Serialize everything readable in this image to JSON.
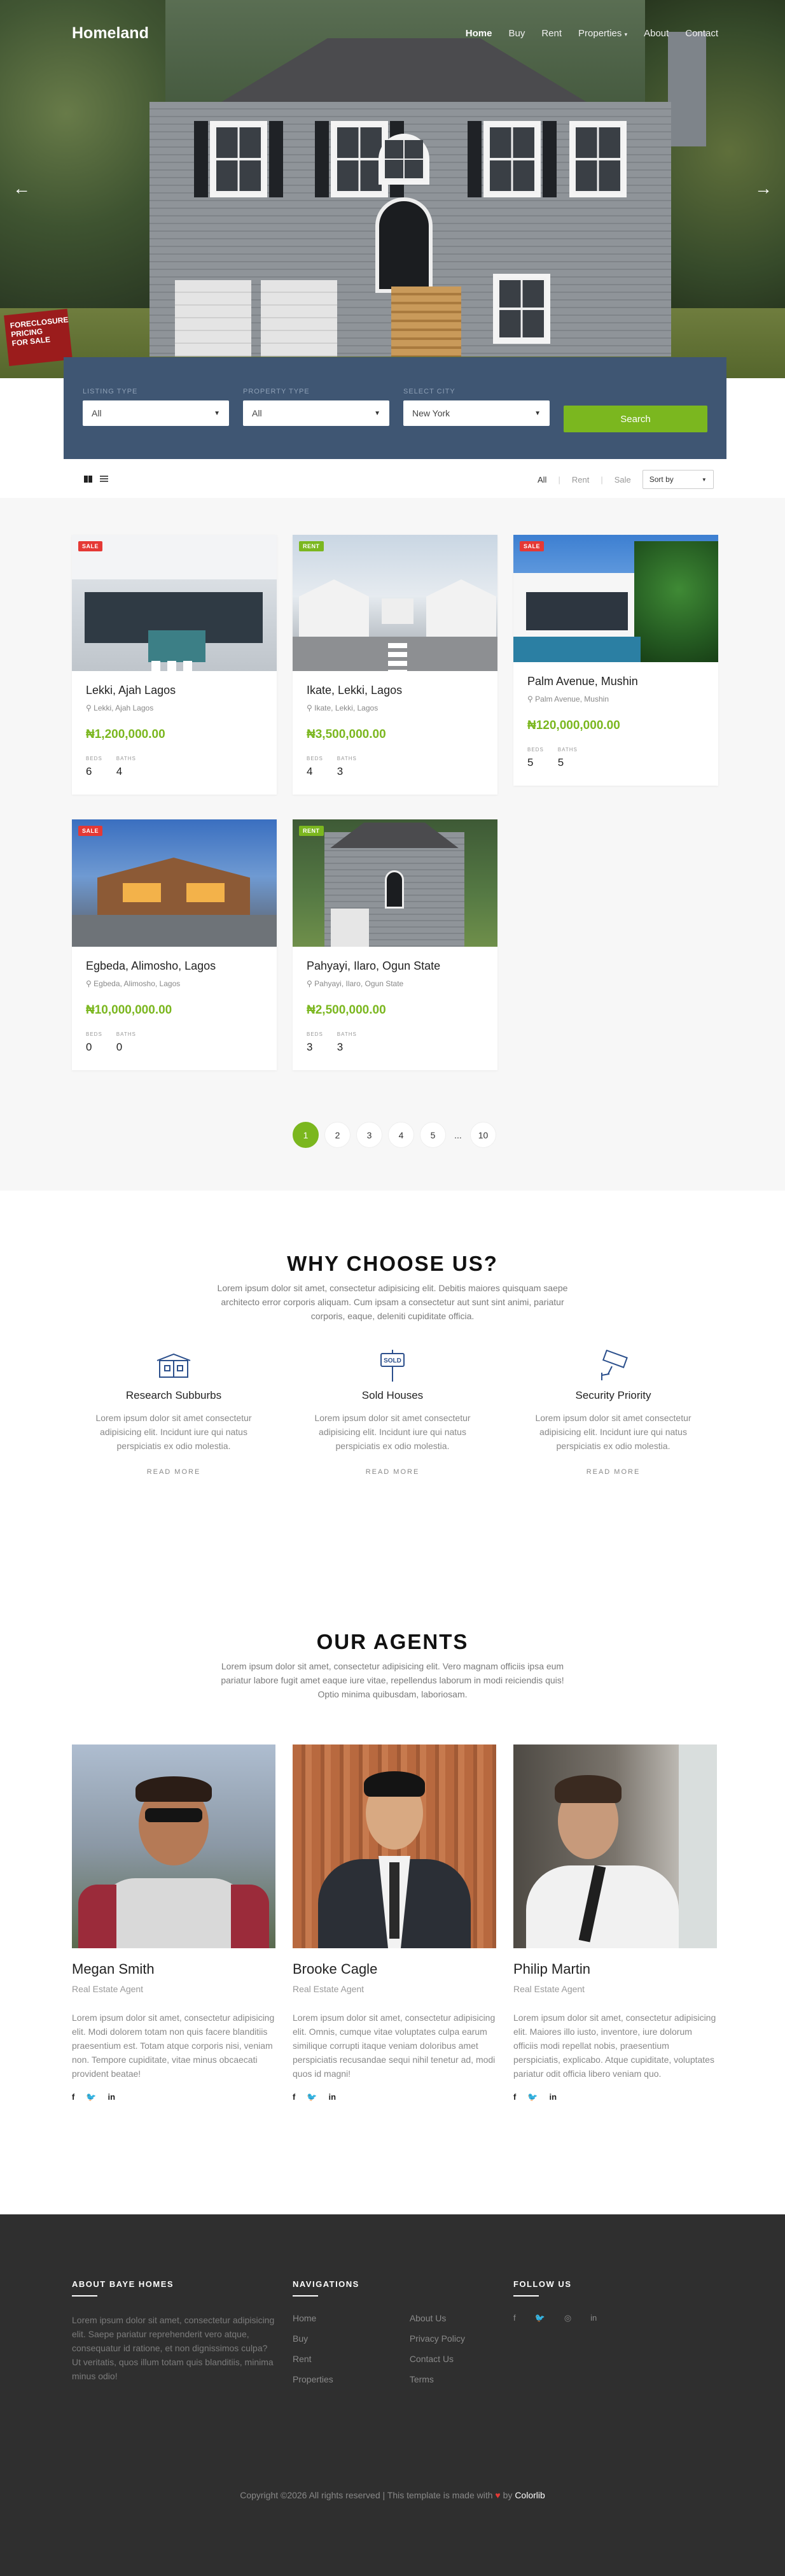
{
  "brand": "Homeland",
  "nav": [
    "Home",
    "Buy",
    "Rent",
    "Properties",
    "About",
    "Contact"
  ],
  "search": {
    "fields": [
      {
        "label": "LISTING TYPE",
        "value": "All"
      },
      {
        "label": "PROPERTY TYPE",
        "value": "All"
      },
      {
        "label": "SELECT CITY",
        "value": "New York"
      }
    ],
    "button": "Search"
  },
  "filters": {
    "all": "All",
    "rent": "Rent",
    "sale": "Sale",
    "sort": "Sort by"
  },
  "listings": [
    {
      "badge": "SALE",
      "title": "Lekki, Ajah Lagos",
      "loc": "Lekki, Ajah Lagos",
      "price": "₦1,200,000.00",
      "beds_label": "BEDS",
      "baths_label": "BATHS",
      "beds": "6",
      "baths": "4"
    },
    {
      "badge": "RENT",
      "title": "Ikate, Lekki, Lagos",
      "loc": "Ikate, Lekki, Lagos",
      "price": "₦3,500,000.00",
      "beds_label": "BEDS",
      "baths_label": "BATHS",
      "beds": "4",
      "baths": "3"
    },
    {
      "badge": "SALE",
      "title": "Palm Avenue, Mushin",
      "loc": "Palm Avenue, Mushin",
      "price": "₦120,000,000.00",
      "beds_label": "BEDS",
      "baths_label": "BATHS",
      "beds": "5",
      "baths": "5"
    },
    {
      "badge": "SALE",
      "title": "Egbeda, Alimosho, Lagos",
      "loc": "Egbeda, Alimosho, Lagos",
      "price": "₦10,000,000.00",
      "beds_label": "BEDS",
      "baths_label": "BATHS",
      "beds": "0",
      "baths": "0"
    },
    {
      "badge": "RENT",
      "title": "Pahyayi, Ilaro, Ogun State",
      "loc": "Pahyayi, Ilaro, Ogun State",
      "price": "₦2,500,000.00",
      "beds_label": "BEDS",
      "baths_label": "BATHS",
      "beds": "3",
      "baths": "3"
    }
  ],
  "pagination": [
    "1",
    "2",
    "3",
    "4",
    "5",
    "...",
    "10"
  ],
  "why": {
    "title": "WHY CHOOSE US?",
    "sub": "Lorem ipsum dolor sit amet, consectetur adipisicing elit. Debitis maiores quisquam saepe architecto error corporis aliquam. Cum ipsam a consectetur aut sunt sint animi, pariatur corporis, eaque, deleniti cupiditate officia.",
    "items": [
      {
        "title": "Research Subburbs",
        "text": "Lorem ipsum dolor sit amet consectetur adipisicing elit. Incidunt iure qui natus perspiciatis ex odio molestia.",
        "more": "READ MORE"
      },
      {
        "title": "Sold Houses",
        "text": "Lorem ipsum dolor sit amet consectetur adipisicing elit. Incidunt iure qui natus perspiciatis ex odio molestia.",
        "more": "READ MORE"
      },
      {
        "title": "Security Priority",
        "text": "Lorem ipsum dolor sit amet consectetur adipisicing elit. Incidunt iure qui natus perspiciatis ex odio molestia.",
        "more": "READ MORE"
      }
    ]
  },
  "agents": {
    "title": "OUR AGENTS",
    "sub": "Lorem ipsum dolor sit amet, consectetur adipisicing elit. Vero magnam officiis ipsa eum pariatur labore fugit amet eaque iure vitae, repellendus laborum in modi reiciendis quis! Optio minima quibusdam, laboriosam.",
    "people": [
      {
        "name": "Megan Smith",
        "role": "Real Estate Agent",
        "bio": "Lorem ipsum dolor sit amet, consectetur adipisicing elit. Modi dolorem totam non quis facere blanditiis praesentium est. Totam atque corporis nisi, veniam non. Tempore cupiditate, vitae minus obcaecati provident beatae!"
      },
      {
        "name": "Brooke Cagle",
        "role": "Real Estate Agent",
        "bio": "Lorem ipsum dolor sit amet, consectetur adipisicing elit. Omnis, cumque vitae voluptates culpa earum similique corrupti itaque veniam doloribus amet perspiciatis recusandae sequi nihil tenetur ad, modi quos id magni!"
      },
      {
        "name": "Philip Martin",
        "role": "Real Estate Agent",
        "bio": "Lorem ipsum dolor sit amet, consectetur adipisicing elit. Maiores illo iusto, inventore, iure dolorum officiis modi repellat nobis, praesentium perspiciatis, explicabo. Atque cupiditate, voluptates pariatur odit officia libero veniam quo."
      }
    ]
  },
  "footer": {
    "about_title": "ABOUT BAYE HOMES",
    "about_text": "Lorem ipsum dolor sit amet, consectetur adipisicing elit. Saepe pariatur reprehenderit vero atque, consequatur id ratione, et non dignissimos culpa? Ut veritatis, quos illum totam quis blanditiis, minima minus odio!",
    "nav_title": "NAVIGATIONS",
    "nav_col1": [
      "Home",
      "Buy",
      "Rent",
      "Properties"
    ],
    "nav_col2": [
      "About Us",
      "Privacy Policy",
      "Contact Us",
      "Terms"
    ],
    "follow_title": "FOLLOW US",
    "copyright_pre": "Copyright ©2026 All rights reserved | This template is made with",
    "copyright_by": "by",
    "copyright_brand": "Colorlib"
  }
}
